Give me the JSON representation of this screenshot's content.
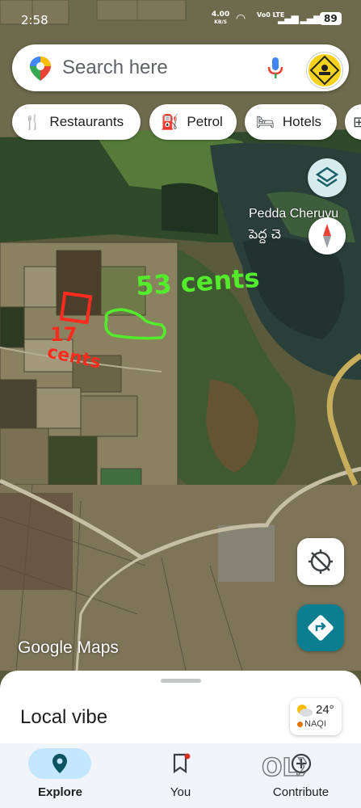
{
  "status_bar": {
    "time": "2:58",
    "net_speed": "4.00",
    "net_unit": "KB/S",
    "volte": "Vo0 LTE",
    "signal_bars": "R",
    "battery": "89"
  },
  "search": {
    "placeholder": "Search here",
    "icons": [
      "maps-pin-icon",
      "microphone-icon",
      "profile-avatar-icon"
    ]
  },
  "chips": [
    {
      "icon": "fork-knife-icon",
      "label": "Restaurants"
    },
    {
      "icon": "fuel-pump-icon",
      "label": "Petrol"
    },
    {
      "icon": "bed-icon",
      "label": "Hotels"
    }
  ],
  "map": {
    "place_name": "Pedda Cheruvu",
    "place_name_local": "పెద్ద చె",
    "annotations": {
      "green_text": "53 cents",
      "red_text_top": "17",
      "red_text_bottom": "cents"
    },
    "attribution": "Google Maps",
    "accent_colors": {
      "green": "#53ec2c",
      "red": "#ff2b1f",
      "road": "#d9c07a"
    }
  },
  "bottom_sheet": {
    "title": "Local vibe",
    "weather": {
      "temp": "24°",
      "air_quality": "NAQI",
      "icon": "partly-cloudy-icon"
    }
  },
  "nav": {
    "items": [
      {
        "label": "Explore",
        "icon": "location-pin-icon",
        "active": true
      },
      {
        "label": "You",
        "icon": "bookmark-icon",
        "active": false
      },
      {
        "label": "Contribute",
        "icon": "add-circle-icon",
        "active": false
      }
    ]
  },
  "watermark": "OLX"
}
